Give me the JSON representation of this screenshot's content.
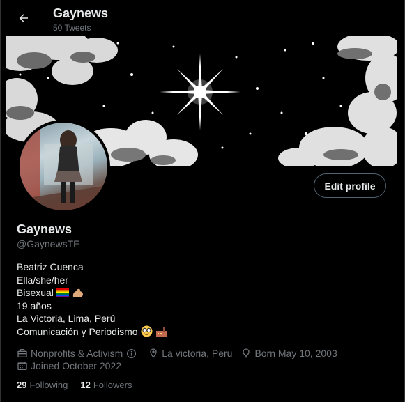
{
  "header": {
    "name": "Gaynews",
    "tweet_count": "50 Tweets"
  },
  "profile": {
    "display_name": "Gaynews",
    "handle": "@GaynewsTE",
    "edit_label": "Edit profile",
    "bio": [
      "Beatriz Cuenca",
      "Ella/she/her",
      "Bisexual",
      "19 años",
      "La Victoria, Lima, Perú",
      "Comunicación y Periodismo"
    ],
    "category": "Nonprofits & Activism",
    "location": "La victoria, Peru",
    "birthday": "Born May 10, 2003",
    "joined": "Joined October 2022",
    "following_count": "29",
    "following_label": "Following",
    "followers_count": "12",
    "followers_label": "Followers"
  },
  "icons": [
    "back-arrow-icon",
    "briefcase-icon",
    "info-icon",
    "location-pin-icon",
    "balloon-icon",
    "calendar-icon",
    "bisexual-flag-emoji",
    "flexed-biceps-emoji",
    "nerd-face-emoji",
    "factory-emoji"
  ],
  "colors": {
    "background": "#000000",
    "text": "#e7e9ea",
    "secondary": "#71767b",
    "border": "#536471"
  }
}
